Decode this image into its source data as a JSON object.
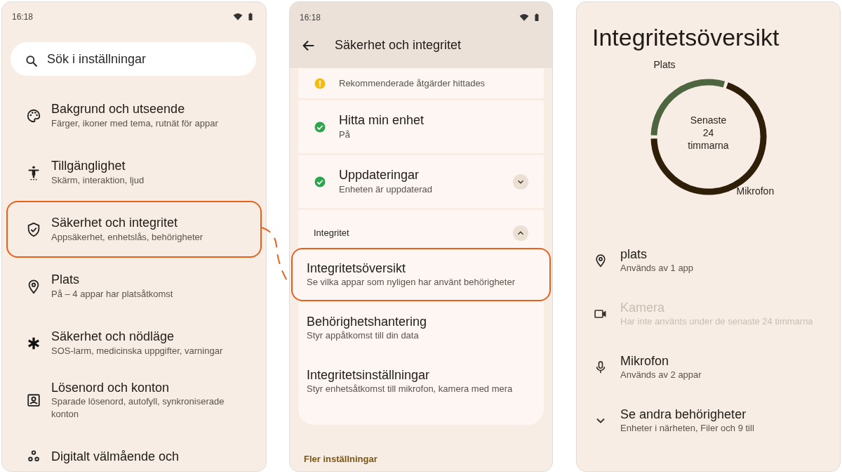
{
  "settings_screen": {
    "status_bar": {
      "time": "16:18"
    },
    "search": {
      "placeholder": "Sök i inställningar"
    },
    "items": [
      {
        "title": "Bakgrund och utseende",
        "subtitle": "Färger, ikoner med tema, rutnät för appar",
        "highlighted": false
      },
      {
        "title": "Tillgänglighet",
        "subtitle": "Skärm, interaktion, ljud",
        "highlighted": false
      },
      {
        "title": "Säkerhet och integritet",
        "subtitle": "Appsäkerhet, enhetslås, behörigheter",
        "highlighted": true
      },
      {
        "title": "Plats",
        "subtitle": "På – 4 appar har platsåtkomst",
        "highlighted": false
      },
      {
        "title": "Säkerhet och nödläge",
        "subtitle": "SOS-larm, medicinska uppgifter, varningar",
        "highlighted": false
      },
      {
        "title": "Lösenord och konton",
        "subtitle": "Sparade lösenord, autofyll, synkroniserade konton",
        "highlighted": false
      },
      {
        "title": "Digitalt välmående och",
        "highlighted": false
      }
    ]
  },
  "security_screen": {
    "status_bar": {
      "time": "16:18"
    },
    "title": "Säkerhet och integritet",
    "cards": [
      {
        "kind": "warning",
        "subtitle": "Rekommenderade åtgärder hittades"
      },
      {
        "kind": "ok",
        "title": "Hitta min enhet",
        "subtitle": "På"
      },
      {
        "kind": "ok",
        "title": "Uppdateringar",
        "subtitle": "Enheten är uppdaterad",
        "expanded": false
      }
    ],
    "section": {
      "title": "Integritet",
      "expanded": true,
      "items": [
        {
          "title": "Integritetsöversikt",
          "subtitle": "Se vilka appar som nyligen har använt behörigheter",
          "highlighted": true
        },
        {
          "title": "Behörighetshantering",
          "subtitle": "Styr appåtkomst till din data",
          "highlighted": false
        },
        {
          "title": "Integritetsinställningar",
          "subtitle": "Styr enhetsåtkomst till mikrofon, kamera med mera",
          "highlighted": false
        }
      ]
    },
    "footer_link": "Fler inställningar"
  },
  "privacy_dashboard": {
    "title": "Integritetsöversikt",
    "chart": {
      "center_text": "Senaste 24 timmarna",
      "segments": [
        {
          "label": "Plats",
          "color": "#4e6640"
        },
        {
          "label": "Mikrofon",
          "color": "#2f1f08"
        }
      ]
    },
    "permissions": [
      {
        "title": "plats",
        "subtitle": "Används av 1 app",
        "disabled": false
      },
      {
        "title": "Kamera",
        "subtitle": "Har inte använts under de senaste 24 timmarna",
        "disabled": true
      },
      {
        "title": "Mikrofon",
        "subtitle": "Används av 2 appar",
        "disabled": false
      },
      {
        "title": "Se andra behörigheter",
        "subtitle": "Enheter i närheten, Filer och 9 till",
        "disabled": false
      }
    ]
  }
}
